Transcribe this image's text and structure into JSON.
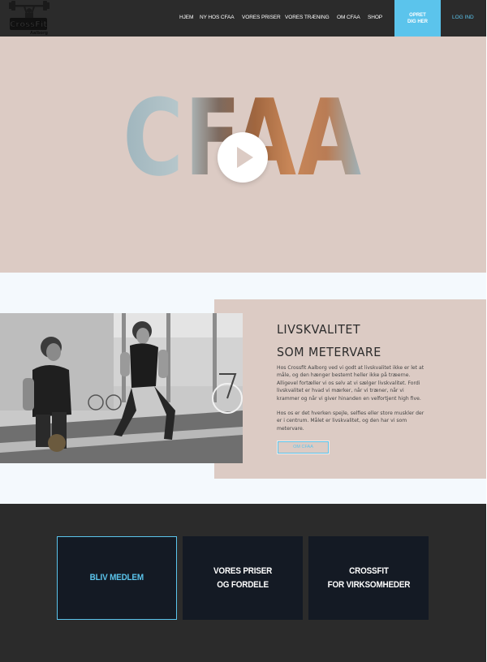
{
  "brand": {
    "logo_text": "CrossFit",
    "logo_subtext": "Aalborg",
    "accent_color": "#5bc4ec",
    "dark_color": "#2b2b2b",
    "beige_color": "#dccbc4"
  },
  "nav": {
    "items": [
      {
        "label": "HJEM"
      },
      {
        "label": "NY HOS CFAA"
      },
      {
        "label": "VORES PRISER"
      },
      {
        "label": "VORES TRÆNING"
      },
      {
        "label": "OM CFAA"
      },
      {
        "label": "SHOP"
      }
    ],
    "cta": {
      "line1": "OPRET",
      "line2": "DIG HER"
    },
    "login_label": "LOG IND"
  },
  "hero": {
    "title": "CFAA",
    "play_icon": "play-icon"
  },
  "about": {
    "heading_line1": "LIVSKVALITET",
    "heading_line2": "SOM METERVARE",
    "paragraph1": "Hos Crossfit Aalborg ved vi godt at livskvalitet ikke er let at måle, og den hænger bestemt heller ikke på træerne. Alligevel fortæller vi os selv at vi sælger livskvalitet. Fordi livskvalitet er hvad vi mærker, når vi træner, når vi krammer og når vi giver hinanden en velfortjent high five.",
    "paragraph2": "Hos os er det hverken spejle, selfies eller store muskler der er i centrum. Målet er livskvalitet, og den har vi som metervare.",
    "button_label": "OM CFAA"
  },
  "cards": [
    {
      "line1": "BLIV MEDLEM",
      "line2": ""
    },
    {
      "line1": "VORES PRISER",
      "line2": "OG FORDELE"
    },
    {
      "line1": "CROSSFIT",
      "line2": "FOR VIRKSOMHEDER"
    }
  ]
}
